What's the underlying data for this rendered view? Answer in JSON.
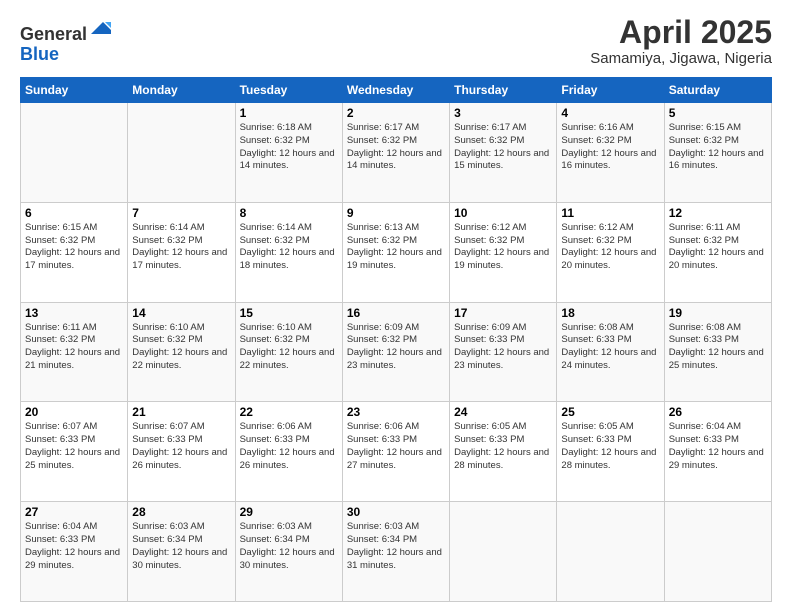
{
  "header": {
    "logo_line1": "General",
    "logo_line2": "Blue",
    "month_title": "April 2025",
    "location": "Samamiya, Jigawa, Nigeria"
  },
  "weekdays": [
    "Sunday",
    "Monday",
    "Tuesday",
    "Wednesday",
    "Thursday",
    "Friday",
    "Saturday"
  ],
  "weeks": [
    [
      {
        "day": "",
        "info": ""
      },
      {
        "day": "",
        "info": ""
      },
      {
        "day": "1",
        "info": "Sunrise: 6:18 AM\nSunset: 6:32 PM\nDaylight: 12 hours and 14 minutes."
      },
      {
        "day": "2",
        "info": "Sunrise: 6:17 AM\nSunset: 6:32 PM\nDaylight: 12 hours and 14 minutes."
      },
      {
        "day": "3",
        "info": "Sunrise: 6:17 AM\nSunset: 6:32 PM\nDaylight: 12 hours and 15 minutes."
      },
      {
        "day": "4",
        "info": "Sunrise: 6:16 AM\nSunset: 6:32 PM\nDaylight: 12 hours and 16 minutes."
      },
      {
        "day": "5",
        "info": "Sunrise: 6:15 AM\nSunset: 6:32 PM\nDaylight: 12 hours and 16 minutes."
      }
    ],
    [
      {
        "day": "6",
        "info": "Sunrise: 6:15 AM\nSunset: 6:32 PM\nDaylight: 12 hours and 17 minutes."
      },
      {
        "day": "7",
        "info": "Sunrise: 6:14 AM\nSunset: 6:32 PM\nDaylight: 12 hours and 17 minutes."
      },
      {
        "day": "8",
        "info": "Sunrise: 6:14 AM\nSunset: 6:32 PM\nDaylight: 12 hours and 18 minutes."
      },
      {
        "day": "9",
        "info": "Sunrise: 6:13 AM\nSunset: 6:32 PM\nDaylight: 12 hours and 19 minutes."
      },
      {
        "day": "10",
        "info": "Sunrise: 6:12 AM\nSunset: 6:32 PM\nDaylight: 12 hours and 19 minutes."
      },
      {
        "day": "11",
        "info": "Sunrise: 6:12 AM\nSunset: 6:32 PM\nDaylight: 12 hours and 20 minutes."
      },
      {
        "day": "12",
        "info": "Sunrise: 6:11 AM\nSunset: 6:32 PM\nDaylight: 12 hours and 20 minutes."
      }
    ],
    [
      {
        "day": "13",
        "info": "Sunrise: 6:11 AM\nSunset: 6:32 PM\nDaylight: 12 hours and 21 minutes."
      },
      {
        "day": "14",
        "info": "Sunrise: 6:10 AM\nSunset: 6:32 PM\nDaylight: 12 hours and 22 minutes."
      },
      {
        "day": "15",
        "info": "Sunrise: 6:10 AM\nSunset: 6:32 PM\nDaylight: 12 hours and 22 minutes."
      },
      {
        "day": "16",
        "info": "Sunrise: 6:09 AM\nSunset: 6:32 PM\nDaylight: 12 hours and 23 minutes."
      },
      {
        "day": "17",
        "info": "Sunrise: 6:09 AM\nSunset: 6:33 PM\nDaylight: 12 hours and 23 minutes."
      },
      {
        "day": "18",
        "info": "Sunrise: 6:08 AM\nSunset: 6:33 PM\nDaylight: 12 hours and 24 minutes."
      },
      {
        "day": "19",
        "info": "Sunrise: 6:08 AM\nSunset: 6:33 PM\nDaylight: 12 hours and 25 minutes."
      }
    ],
    [
      {
        "day": "20",
        "info": "Sunrise: 6:07 AM\nSunset: 6:33 PM\nDaylight: 12 hours and 25 minutes."
      },
      {
        "day": "21",
        "info": "Sunrise: 6:07 AM\nSunset: 6:33 PM\nDaylight: 12 hours and 26 minutes."
      },
      {
        "day": "22",
        "info": "Sunrise: 6:06 AM\nSunset: 6:33 PM\nDaylight: 12 hours and 26 minutes."
      },
      {
        "day": "23",
        "info": "Sunrise: 6:06 AM\nSunset: 6:33 PM\nDaylight: 12 hours and 27 minutes."
      },
      {
        "day": "24",
        "info": "Sunrise: 6:05 AM\nSunset: 6:33 PM\nDaylight: 12 hours and 28 minutes."
      },
      {
        "day": "25",
        "info": "Sunrise: 6:05 AM\nSunset: 6:33 PM\nDaylight: 12 hours and 28 minutes."
      },
      {
        "day": "26",
        "info": "Sunrise: 6:04 AM\nSunset: 6:33 PM\nDaylight: 12 hours and 29 minutes."
      }
    ],
    [
      {
        "day": "27",
        "info": "Sunrise: 6:04 AM\nSunset: 6:33 PM\nDaylight: 12 hours and 29 minutes."
      },
      {
        "day": "28",
        "info": "Sunrise: 6:03 AM\nSunset: 6:34 PM\nDaylight: 12 hours and 30 minutes."
      },
      {
        "day": "29",
        "info": "Sunrise: 6:03 AM\nSunset: 6:34 PM\nDaylight: 12 hours and 30 minutes."
      },
      {
        "day": "30",
        "info": "Sunrise: 6:03 AM\nSunset: 6:34 PM\nDaylight: 12 hours and 31 minutes."
      },
      {
        "day": "",
        "info": ""
      },
      {
        "day": "",
        "info": ""
      },
      {
        "day": "",
        "info": ""
      }
    ]
  ]
}
